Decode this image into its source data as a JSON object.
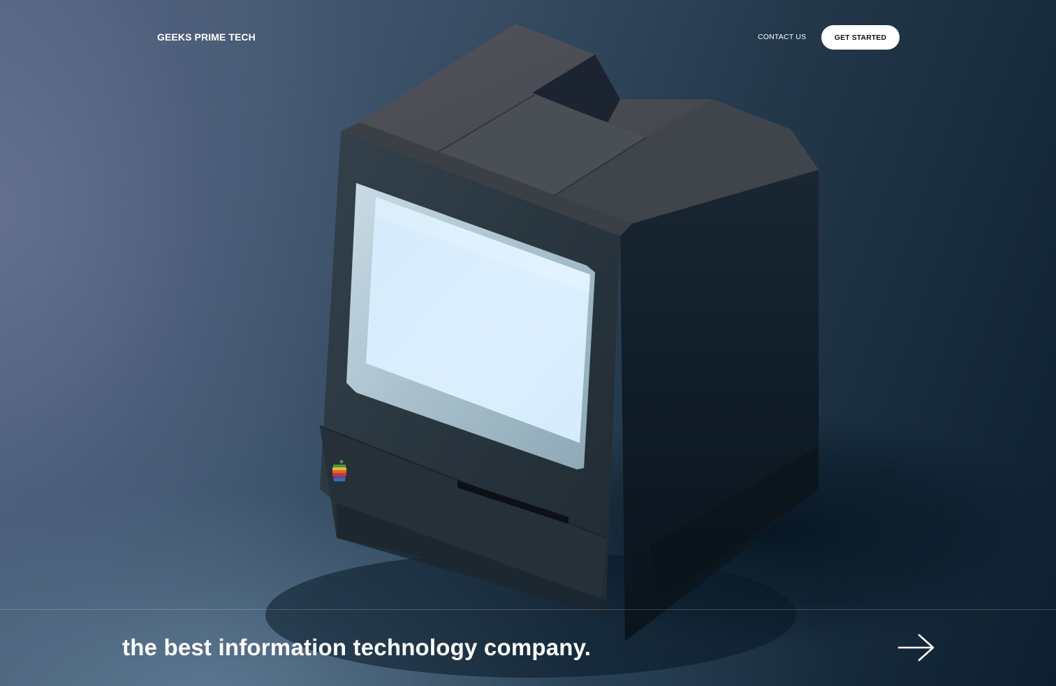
{
  "nav": {
    "brand": "GEEKS PRIME TECH",
    "contact_label": "CONTACT US",
    "cta_label": "GET STARTED"
  },
  "hero": {
    "tagline": "the best information technology company.",
    "arrow_icon": "arrow-right-icon",
    "illustration_icon": "retro-computer-illustration"
  },
  "colors": {
    "accent": "#ffffff",
    "background_dark": "#0d1f2f",
    "background_light": "#56637e",
    "screen_glow": "#dbeefb"
  }
}
